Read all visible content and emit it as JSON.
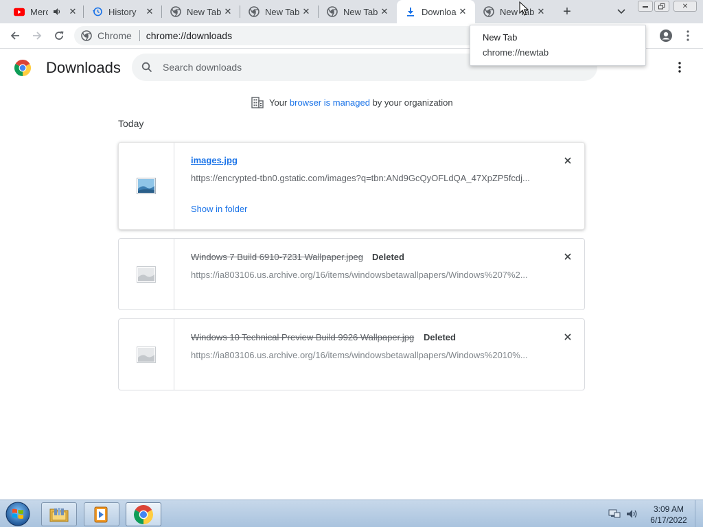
{
  "tabs": [
    {
      "title": "Merc",
      "icon": "youtube-icon",
      "muted_icon": "speaker-icon"
    },
    {
      "title": "History",
      "icon": "history-icon"
    },
    {
      "title": "New Tab",
      "icon": "chrome-icon"
    },
    {
      "title": "New Tab",
      "icon": "chrome-icon"
    },
    {
      "title": "New Tab",
      "icon": "chrome-icon"
    },
    {
      "title": "Downloa",
      "icon": "download-icon",
      "active": true
    },
    {
      "title": "New Tab",
      "icon": "chrome-icon"
    }
  ],
  "toolbar": {
    "chip_label": "Chrome",
    "url": "chrome://downloads"
  },
  "hover_card": {
    "title": "New Tab",
    "url": "chrome://newtab"
  },
  "page": {
    "title": "Downloads",
    "search_placeholder": "Search downloads",
    "managed_prefix": "Your ",
    "managed_link": "browser is managed",
    "managed_suffix": " by your organization",
    "date_header": "Today"
  },
  "downloads": [
    {
      "filename": "images.jpg",
      "url": "https://encrypted-tbn0.gstatic.com/images?q=tbn:ANd9GcQyOFLdQA_47XpZP5fcdj...",
      "action": "Show in folder",
      "status": ""
    },
    {
      "filename": "Windows 7 Build 6910-7231 Wallpaper.jpeg",
      "url": "https://ia803106.us.archive.org/16/items/windowsbetawallpapers/Windows%207%2...",
      "status": "Deleted"
    },
    {
      "filename": "Windows 10 Technical Preview Build 9926 Wallpaper.jpg",
      "url": "https://ia803106.us.archive.org/16/items/windowsbetawallpapers/Windows%2010%...",
      "status": "Deleted"
    }
  ],
  "taskbar": {
    "time": "3:09 AM",
    "date": "6/17/2022",
    "items": [
      "file-explorer-icon",
      "media-player-icon",
      "chrome-icon"
    ]
  },
  "colors": {
    "link": "#1a73e8",
    "tabstrip": "#dee1e6",
    "omnibox": "#f1f3f4"
  }
}
